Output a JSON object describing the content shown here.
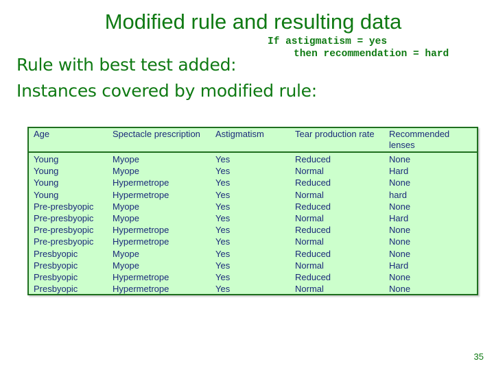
{
  "slide": {
    "title": "Modified rule and resulting data",
    "rule_line1": "If astigmatism = yes",
    "rule_line2": "then recommendation = hard",
    "heading1": "Rule with best test added:",
    "heading2": "Instances covered by modified rule:",
    "page_number": "35"
  },
  "table": {
    "columns": [
      "Age",
      "Spectacle prescription",
      "Astigmatism",
      "Tear production rate",
      "Recommended lenses"
    ],
    "rows": [
      [
        "Young",
        "Myope",
        "Yes",
        "Reduced",
        "None"
      ],
      [
        "Young",
        "Myope",
        "Yes",
        "Normal",
        "Hard"
      ],
      [
        "Young",
        "Hypermetrope",
        "Yes",
        "Reduced",
        "None"
      ],
      [
        "Young",
        "Hypermetrope",
        "Yes",
        "Normal",
        "hard"
      ],
      [
        "Pre-presbyopic",
        "Myope",
        "Yes",
        "Reduced",
        "None"
      ],
      [
        "Pre-presbyopic",
        "Myope",
        "Yes",
        "Normal",
        "Hard"
      ],
      [
        "Pre-presbyopic",
        "Hypermetrope",
        "Yes",
        "Reduced",
        "None"
      ],
      [
        "Pre-presbyopic",
        "Hypermetrope",
        "Yes",
        "Normal",
        "None"
      ],
      [
        "Presbyopic",
        "Myope",
        "Yes",
        "Reduced",
        "None"
      ],
      [
        "Presbyopic",
        "Myope",
        "Yes",
        "Normal",
        "Hard"
      ],
      [
        "Presbyopic",
        "Hypermetrope",
        "Yes",
        "Reduced",
        "None"
      ],
      [
        "Presbyopic",
        "Hypermetrope",
        "Yes",
        "Normal",
        "None"
      ]
    ]
  },
  "colors": {
    "accent_green": "#0f7a13",
    "table_fill": "#ccffcc",
    "table_border": "#1e6e1e",
    "table_text": "#1a2a7a"
  }
}
